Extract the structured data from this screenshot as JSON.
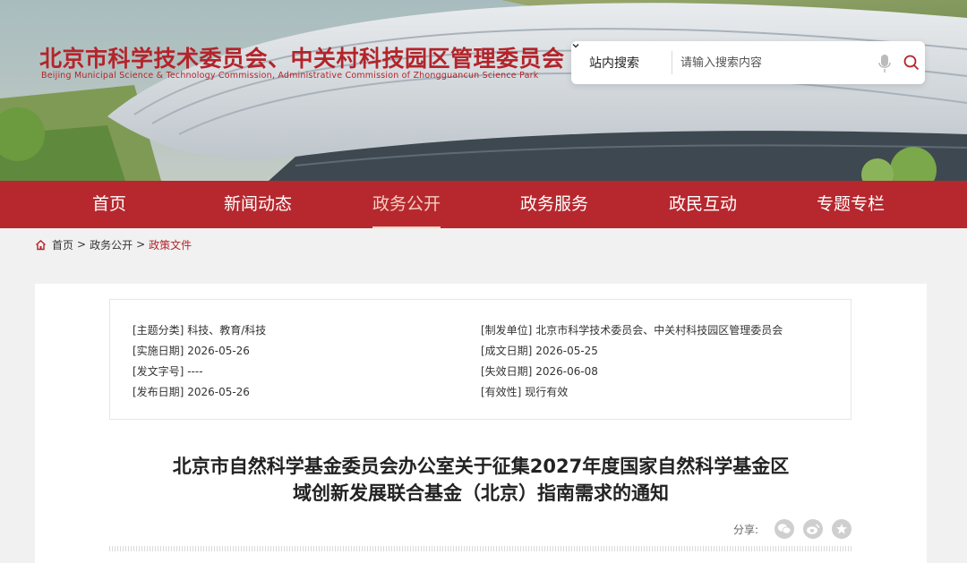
{
  "header": {
    "logo_cn": "北京市科学技术委员会、中关村科技园区管理委员会",
    "logo_en": "Beijing Municipal Science & Technology Commission, Administrative Commission of Zhongguancun Science Park"
  },
  "search": {
    "scope_label": "站内搜索",
    "placeholder": "请输入搜索内容"
  },
  "nav": {
    "items": [
      {
        "label": "首页"
      },
      {
        "label": "新闻动态"
      },
      {
        "label": "政务公开"
      },
      {
        "label": "政务服务"
      },
      {
        "label": "政民互动"
      },
      {
        "label": "专题专栏"
      }
    ],
    "active_index": 2
  },
  "breadcrumb": {
    "home": "首页",
    "separator": ">",
    "level2": "政务公开",
    "current": "政策文件"
  },
  "meta": {
    "topic_label": "[主题分类]",
    "topic_value": "科技、教育/科技",
    "issuer_label": "[制发单位]",
    "issuer_value": "北京市科学技术委员会、中关村科技园区管理委员会",
    "effective_label": "[实施日期]",
    "effective_value": "2026-05-26",
    "formed_label": "[成文日期]",
    "formed_value": "2026-05-25",
    "docno_label": "[发文字号]",
    "docno_value": "----",
    "expire_label": "[失效日期]",
    "expire_value": "2026-06-08",
    "publish_label": "[发布日期]",
    "publish_value": "2026-05-26",
    "validity_label": "[有效性]",
    "validity_value": "现行有效"
  },
  "article": {
    "title_line1": "北京市自然科学基金委员会办公室关于征集2027年度国家自然科学基金区",
    "title_line2": "域创新发展联合基金（北京）指南需求的通知"
  },
  "share": {
    "label": "分享:"
  },
  "colors": {
    "brand_red": "#b6282e",
    "nav_active": "#f3cfc2",
    "breadcrumb_current": "#b3242a"
  }
}
